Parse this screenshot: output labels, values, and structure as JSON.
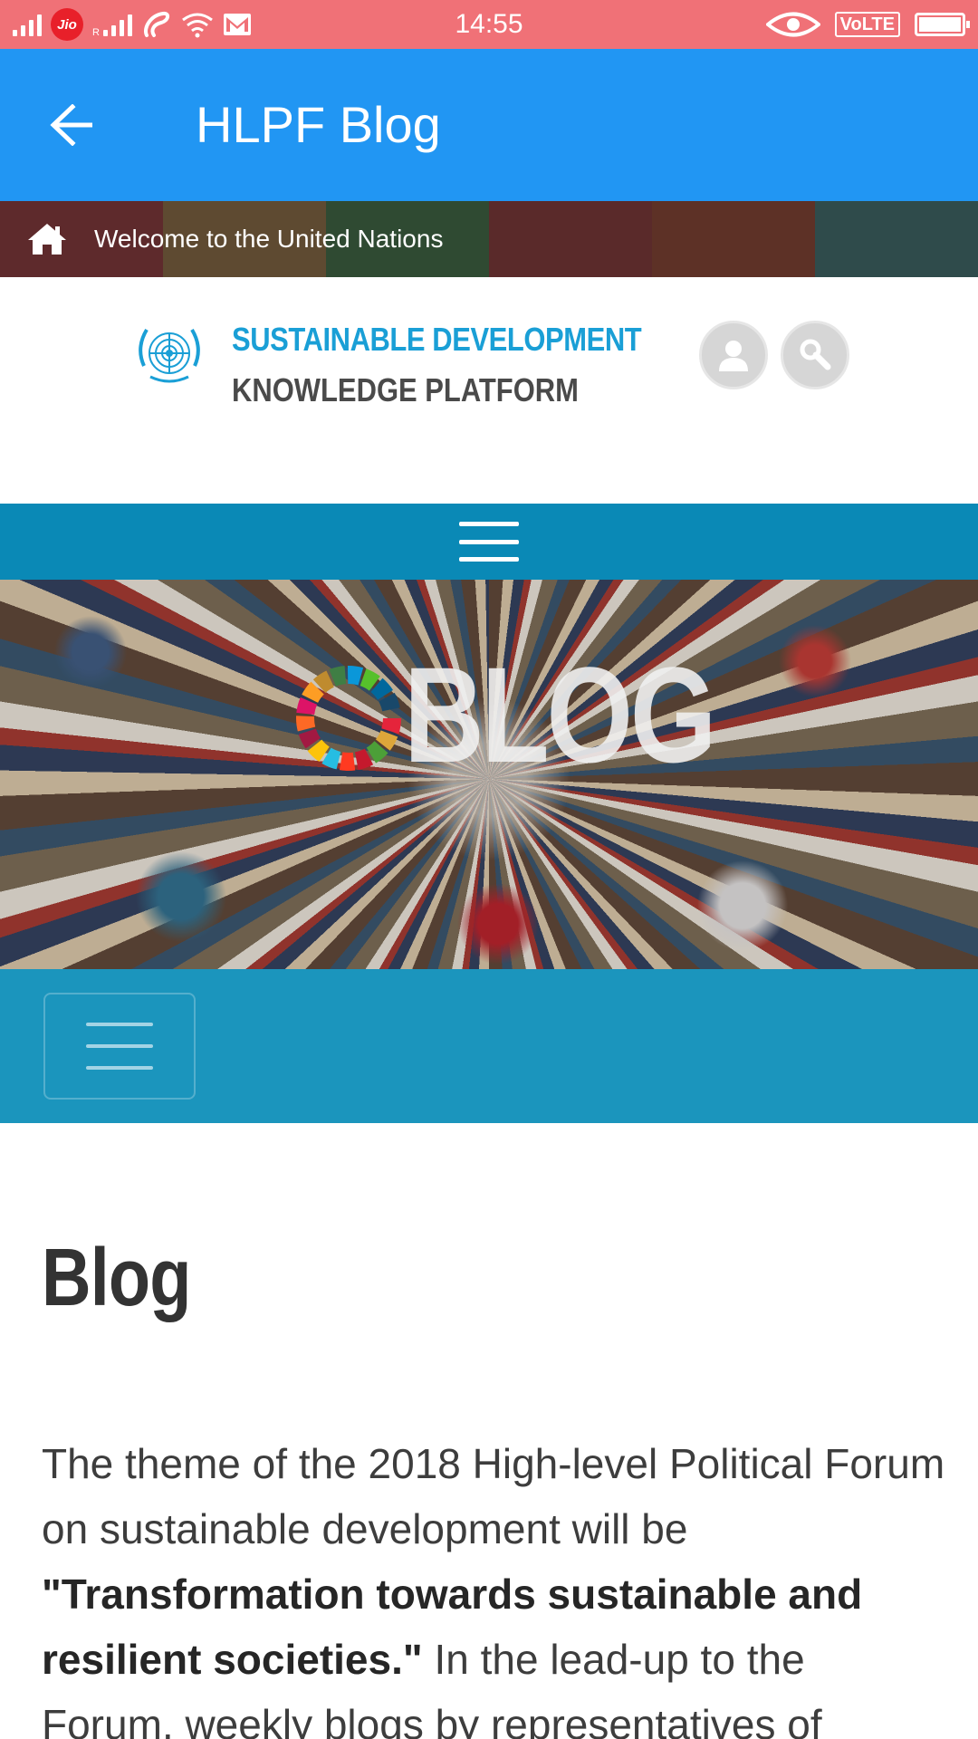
{
  "status_bar": {
    "time": "14:55",
    "carrier": "Jio",
    "volte": "VoLTE"
  },
  "app_bar": {
    "title": "HLPF Blog"
  },
  "un_strip": {
    "welcome": "Welcome to the United Nations",
    "colors": [
      "#5e2a2c",
      "#5e4a31",
      "#2f4a32",
      "#5a2a2a",
      "#5d3126",
      "#2f4b4b"
    ]
  },
  "site_header": {
    "brand_line1": "SUSTAINABLE DEVELOPMENT",
    "brand_line2": "KNOWLEDGE PLATFORM"
  },
  "banner": {
    "title": "BLOG"
  },
  "content": {
    "heading": "Blog",
    "intro_part1": "The theme of the 2018 High-level Political Forum on sustainable development will be ",
    "intro_bold": "\"Transformation towards sustainable and resilient societies.\"",
    "intro_part2": " In the lead-up to the Forum, weekly blogs by representatives of Member"
  },
  "colors": {
    "status_bar": "#f07177",
    "app_bar": "#2196f3",
    "nav_teal": "#0a89b6",
    "sub_nav": "#1b95bd",
    "brand_blue": "#1a9fd6"
  },
  "icons": [
    "back-arrow-icon",
    "home-icon",
    "user-icon",
    "search-icon",
    "menu-icon",
    "un-emblem-icon",
    "sdg-wheel-icon"
  ]
}
